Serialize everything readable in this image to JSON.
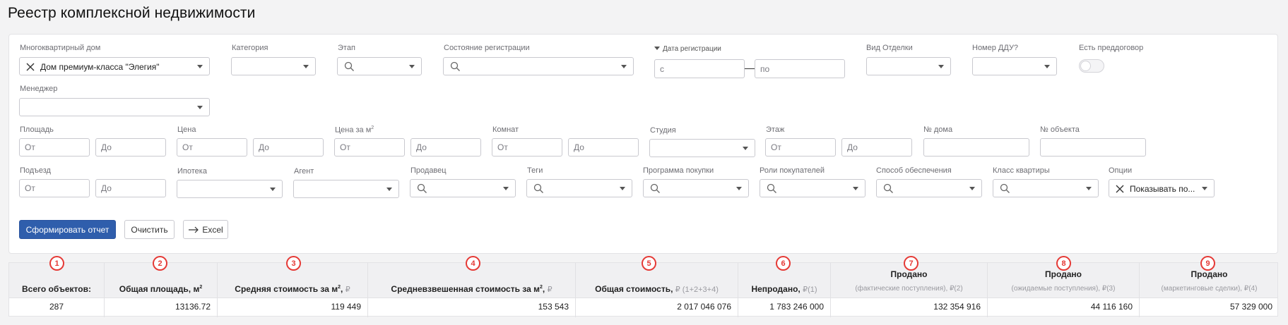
{
  "page": {
    "title": "Реестр комплексной недвижимости"
  },
  "filters": {
    "building": {
      "label": "Многоквартирный дом",
      "value": "Дом премиум-класса \"Элегия\""
    },
    "category": {
      "label": "Категория"
    },
    "stage": {
      "label": "Этап"
    },
    "registration_state": {
      "label": "Состояние регистрации"
    },
    "registration_date": {
      "label": "Дата регистрации",
      "from_placeholder": "с",
      "to_placeholder": "по"
    },
    "finish_type": {
      "label": "Вид Отделки"
    },
    "ddu_number": {
      "label": "Номер ДДУ?"
    },
    "preliminary": {
      "label": "Есть преддоговор",
      "enabled": false
    },
    "manager": {
      "label": "Менеджер"
    },
    "area": {
      "label": "Площадь",
      "from_placeholder": "От",
      "to_placeholder": "До"
    },
    "price": {
      "label": "Цена",
      "from_placeholder": "От",
      "to_placeholder": "До"
    },
    "price_per_m2": {
      "label": "Цена за м",
      "from_placeholder": "От",
      "to_placeholder": "До"
    },
    "rooms": {
      "label": "Комнат",
      "from_placeholder": "От",
      "to_placeholder": "До"
    },
    "studio": {
      "label": "Студия"
    },
    "floor": {
      "label": "Этаж",
      "from_placeholder": "От",
      "to_placeholder": "До"
    },
    "house_number": {
      "label": "№ дома"
    },
    "object_number": {
      "label": "№ объекта"
    },
    "entrance": {
      "label": "Подъезд",
      "from_placeholder": "От",
      "to_placeholder": "До"
    },
    "mortgage": {
      "label": "Ипотека"
    },
    "agent": {
      "label": "Агент"
    },
    "seller": {
      "label": "Продавец"
    },
    "tags": {
      "label": "Теги"
    },
    "purchase_program": {
      "label": "Программа покупки"
    },
    "buyer_roles": {
      "label": "Роли покупателей"
    },
    "security_method": {
      "label": "Способ обеспечения"
    },
    "apartment_class": {
      "label": "Класс квартиры"
    },
    "options": {
      "label": "Опции",
      "value": "Показывать по..."
    }
  },
  "actions": {
    "generate_label": "Сформировать отчет",
    "clear_label": "Очистить",
    "excel_label": "Excel"
  },
  "summary": {
    "columns": [
      {
        "marker": "1",
        "title": "Всего объектов:",
        "unit": "",
        "value": "287"
      },
      {
        "marker": "2",
        "title": "Общая площадь, м",
        "unit": "",
        "value": "13136.72"
      },
      {
        "marker": "3",
        "title": "Средняя стоимость за м",
        "unit": "₽",
        "value": "119 449"
      },
      {
        "marker": "4",
        "title": "Средневзвешенная стоимость за м",
        "unit": "₽",
        "value": "153 543"
      },
      {
        "marker": "5",
        "title": "Общая стоимость,",
        "unit": "₽ (1+2+3+4)",
        "value": "2 017 046 076"
      },
      {
        "marker": "6",
        "title": "Непродано,",
        "unit": "₽(1)",
        "value": "1 783 246 000"
      },
      {
        "marker": "7",
        "title": "Продано",
        "subtitle": "(фактические поступления), ₽(2)",
        "value": "132 354 916"
      },
      {
        "marker": "8",
        "title": "Продано",
        "subtitle": "(ожидаемые поступления), ₽(3)",
        "value": "44 116 160"
      },
      {
        "marker": "9",
        "title": "Продано",
        "subtitle": "(маркетинговые сделки), ₽(4)",
        "value": "57 329 000"
      }
    ]
  },
  "superscript": "2"
}
